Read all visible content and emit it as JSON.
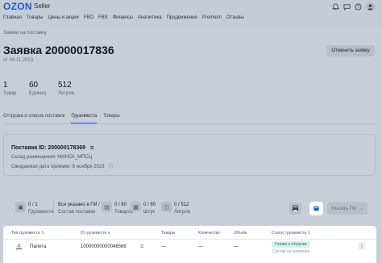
{
  "header": {
    "logo": "OZON",
    "logo_sub": "Seller",
    "nav": [
      "Главная",
      "Товары",
      "Цены и акции",
      "FBO",
      "FBS",
      "Финансы",
      "Аналитика",
      "Продвижение",
      "Premium",
      "Отзывы"
    ],
    "icons": [
      "bell-icon",
      "chat-icon",
      "help-icon",
      "user-icon"
    ]
  },
  "breadcrumb": "Заявки на поставку",
  "page": {
    "title": "Заявка 20000017836",
    "subtitle": "от 06.11.2023",
    "cancel_label": "Отменить заявку"
  },
  "stats": [
    {
      "value": "1",
      "label": "Товар"
    },
    {
      "value": "60",
      "label": "Единиц"
    },
    {
      "value": "512",
      "label": "Литров"
    }
  ],
  "tabs": [
    {
      "label": "Отгрузка и список поставок",
      "active": false
    },
    {
      "label": "Грузоместа",
      "active": true
    },
    {
      "label": "Товары",
      "active": false
    }
  ],
  "delivery": {
    "title": "Поставка ID: 200000178369",
    "warehouse": "Склад размещения: МИНСК_МПСЦ",
    "expected_date": "Ожидаемая дата приёмки: 8 ноября 2023"
  },
  "summary": [
    {
      "value": "0 / 1",
      "label": "Грузоместа",
      "icon": "box-icon"
    },
    {
      "value": "Все указано в ГМ / 1",
      "label": "Состав поставки",
      "icon": "list-icon"
    },
    {
      "value": "0 / 60",
      "label": "Товаров",
      "icon": "package-icon"
    },
    {
      "value": "0 / 60",
      "label": "Штук",
      "icon": "pieces-icon"
    },
    {
      "value": "0 / 512",
      "label": "Литров",
      "icon": "volume-icon"
    }
  ],
  "actions": {
    "ship_label": "Указать ГМ"
  },
  "table": {
    "headers": [
      "Тип грузоместа",
      "ID грузоместа",
      "Товары",
      "Количество",
      "Объём",
      "Статус грузоместа"
    ],
    "row": {
      "type": "Палета",
      "id": "10000000000046568",
      "goods": "—",
      "quantity": "—",
      "volume": "—",
      "status": "Готово к отгрузке",
      "status_sub": "Состав не заполнен"
    }
  },
  "colors": {
    "accent": "#1f5bd8",
    "status_bg": "#d6f2ee",
    "status_text": "#0f6e5f"
  }
}
